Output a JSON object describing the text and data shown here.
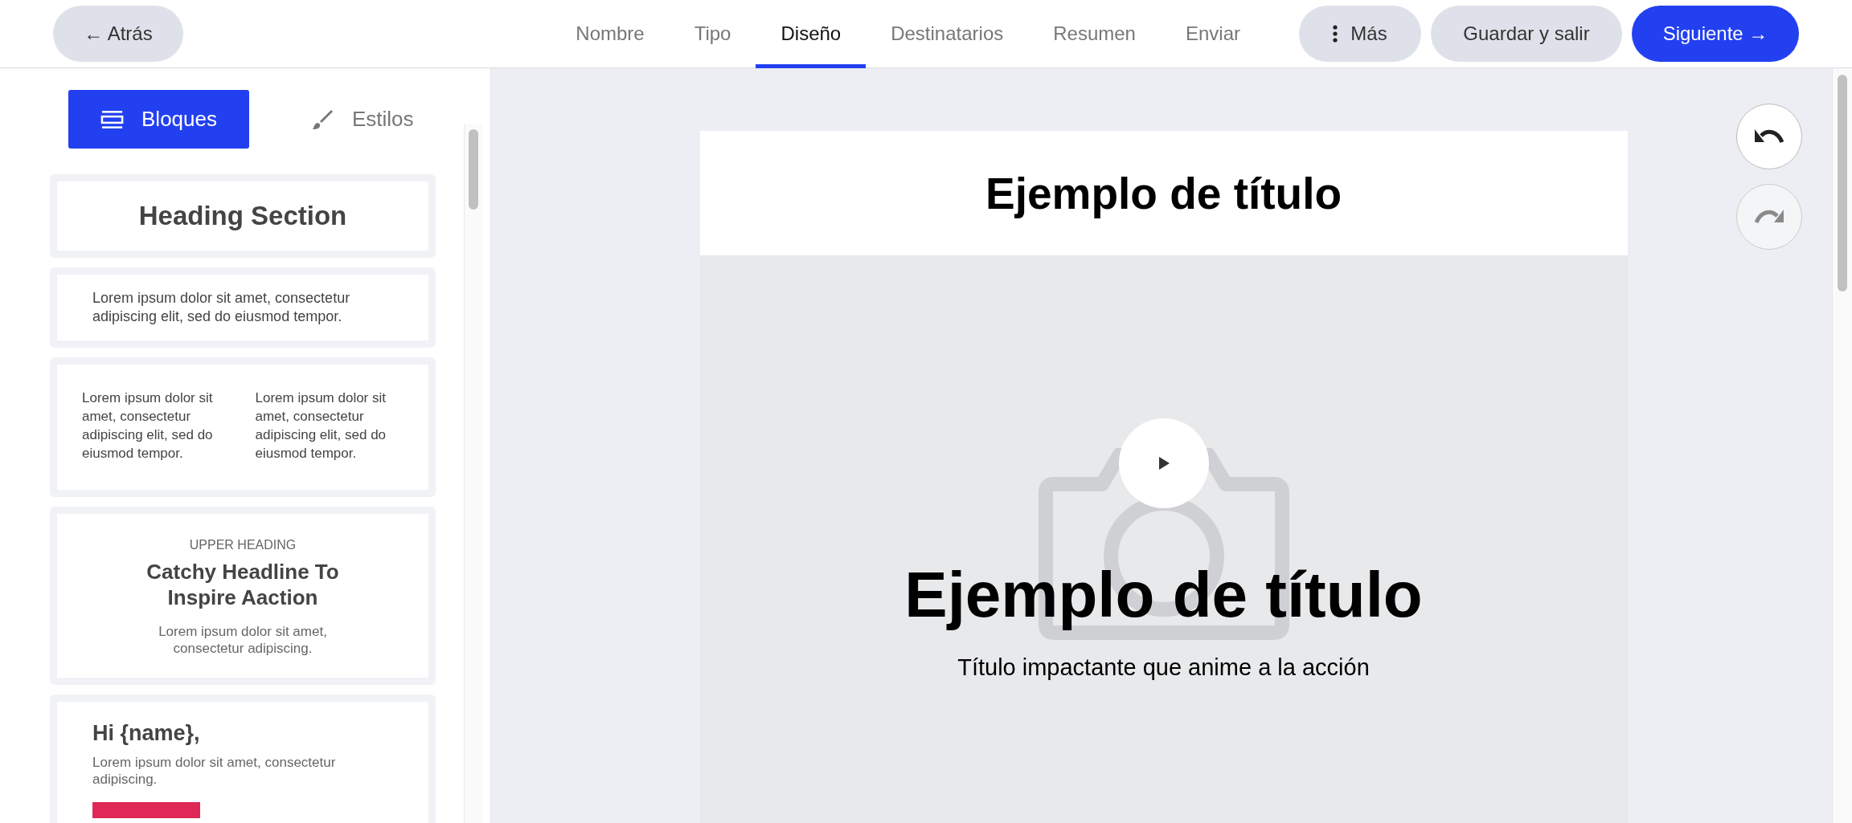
{
  "header": {
    "back_button": "← Atrás",
    "steps": [
      {
        "label": "Nombre",
        "selected": false
      },
      {
        "label": "Tipo",
        "selected": false
      },
      {
        "label": "Diseño",
        "selected": true
      },
      {
        "label": "Destinatarios",
        "selected": false
      },
      {
        "label": "Resumen",
        "selected": false
      },
      {
        "label": "Enviar",
        "selected": false
      }
    ],
    "more_button": "Más",
    "save_button": "Guardar y salir",
    "next_button": "Siguiente →"
  },
  "sidebar": {
    "tabs": [
      {
        "label": "Bloques",
        "kind": "blocks",
        "selected": true
      },
      {
        "label": "Estilos",
        "kind": "styles",
        "selected": false
      }
    ],
    "blocks": [
      {
        "kind": "heading",
        "title": "Heading Section"
      },
      {
        "kind": "text",
        "text": "Lorem ipsum dolor sit amet, consectetur adipiscing elit, sed do eiusmod tempor."
      },
      {
        "kind": "columns",
        "columns": [
          "Lorem ipsum dolor sit amet, consectetur adipiscing elit, sed do eiusmod tempor.",
          "Lorem ipsum dolor sit amet, consectetur adipiscing elit, sed do eiusmod tempor."
        ]
      },
      {
        "kind": "hero",
        "eyebrow": "UPPER HEADING",
        "title": "Catchy Headline To Inspire Aaction",
        "text": "Lorem ipsum dolor sit amet, consectetur adipiscing."
      },
      {
        "kind": "greeting",
        "title": "Hi {name},",
        "text": "Lorem ipsum dolor sit amet, consectetur adipiscing."
      }
    ]
  },
  "canvas": {
    "undo_disabled": false,
    "redo_disabled": true,
    "email": {
      "header_title": "Ejemplo de título",
      "hero_title": "Ejemplo de título",
      "hero_subtitle": "Título impactante que anime a la acción"
    }
  }
}
